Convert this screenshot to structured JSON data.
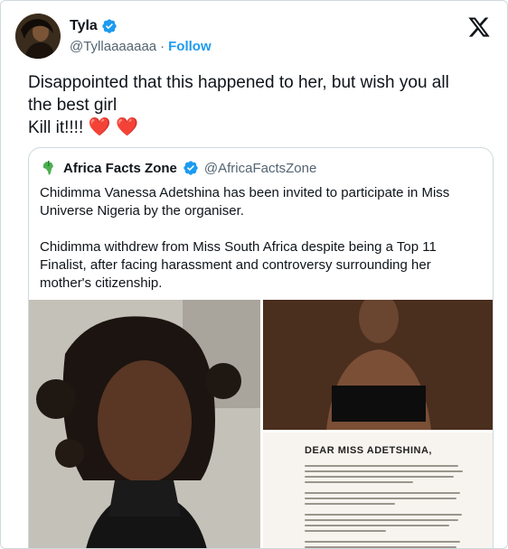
{
  "user": {
    "name": "Tyla",
    "handle": "@Tyllaaaaaaa",
    "separator": "·",
    "follow_label": "Follow"
  },
  "tweet": {
    "line1": "Disappointed that this happened to her, but wish you all",
    "line2": "the best girl",
    "line3": "Kill it!!!!",
    "hearts": "❤️ ❤️"
  },
  "quote": {
    "name": "Africa Facts Zone",
    "handle": "@AfricaFactsZone",
    "paragraph1": "Chidimma Vanessa Adetshina has been invited to participate in Miss Universe Nigeria by the organiser.",
    "paragraph2": "Chidimma withdrew from Miss South Africa despite being a Top 11 Finalist, after facing harassment and controversy surrounding her mother's citizenship."
  },
  "letter": {
    "salutation": "DEAR MISS ADETSHINA,"
  },
  "colors": {
    "accent": "#1d9bf0",
    "verified": "#1d9bf0",
    "heart": "#c62828"
  },
  "icons": {
    "verified": "verified-badge-icon",
    "x_logo": "x-logo-icon",
    "africa": "africa-logo-icon"
  }
}
